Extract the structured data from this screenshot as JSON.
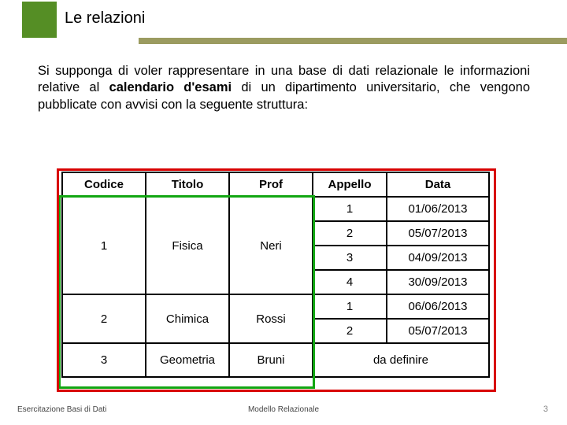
{
  "title": "Le relazioni",
  "body_parts": {
    "p1": "Si supponga di voler rappresentare in una base di dati relazionale le informazioni relative al ",
    "p2": "calendario d'esami",
    "p3": " di un dipartimento universitario, che vengono pubblicate con avvisi con la seguente struttura:"
  },
  "table": {
    "headers": {
      "codice": "Codice",
      "titolo": "Titolo",
      "prof": "Prof",
      "appello": "Appello",
      "data": "Data"
    },
    "row1": {
      "codice": "1",
      "titolo": "Fisica",
      "prof": "Neri",
      "app": {
        "a1": "1",
        "a2": "2",
        "a3": "3",
        "a4": "4"
      },
      "dat": {
        "d1": "01/06/2013",
        "d2": "05/07/2013",
        "d3": "04/09/2013",
        "d4": "30/09/2013"
      }
    },
    "row2": {
      "codice": "2",
      "titolo": "Chimica",
      "prof": "Rossi",
      "app": {
        "a1": "1",
        "a2": "2"
      },
      "dat": {
        "d1": "06/06/2013",
        "d2": "05/07/2013"
      }
    },
    "row3": {
      "codice": "3",
      "titolo": "Geometria",
      "prof": "Bruni",
      "merged": "da definire"
    }
  },
  "footer": {
    "left": "Esercitazione Basi di Dati",
    "center": "Modello Relazionale",
    "right": "3"
  }
}
